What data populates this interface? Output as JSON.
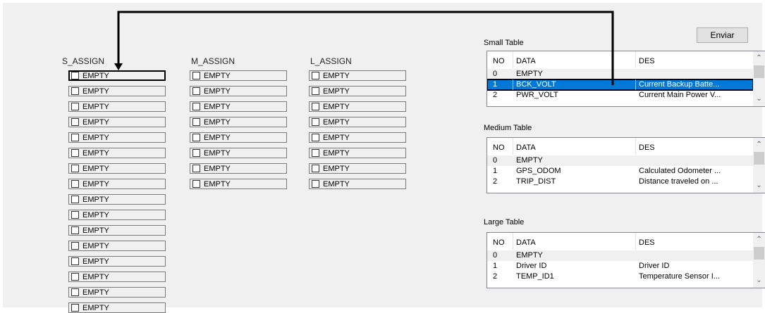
{
  "columns": {
    "s_assign": {
      "title": "S_ASSIGN",
      "items": [
        "EMPTY",
        "EMPTY",
        "EMPTY",
        "EMPTY",
        "EMPTY",
        "EMPTY",
        "EMPTY",
        "EMPTY",
        "EMPTY",
        "EMPTY",
        "EMPTY",
        "EMPTY",
        "EMPTY",
        "EMPTY",
        "EMPTY",
        "EMPTY"
      ]
    },
    "m_assign": {
      "title": "M_ASSIGN",
      "items": [
        "EMPTY",
        "EMPTY",
        "EMPTY",
        "EMPTY",
        "EMPTY",
        "EMPTY",
        "EMPTY",
        "EMPTY"
      ]
    },
    "l_assign": {
      "title": "L_ASSIGN",
      "items": [
        "EMPTY",
        "EMPTY",
        "EMPTY",
        "EMPTY",
        "EMPTY",
        "EMPTY",
        "EMPTY",
        "EMPTY"
      ]
    }
  },
  "send_button": {
    "label": "Enviar"
  },
  "tables": {
    "small": {
      "title": "Small Table",
      "headers": [
        "NO",
        "DATA",
        "DES"
      ],
      "rows": [
        [
          "0",
          "EMPTY",
          ""
        ],
        [
          "1",
          "BCK_VOLT",
          "Current Backup Batte..."
        ],
        [
          "2",
          "PWR_VOLT",
          "Current Main Power V..."
        ]
      ]
    },
    "medium": {
      "title": "Medium Table",
      "headers": [
        "NO",
        "DATA",
        "DES"
      ],
      "rows": [
        [
          "0",
          "EMPTY",
          ""
        ],
        [
          "1",
          "GPS_ODOM",
          "Calculated Odometer ..."
        ],
        [
          "2",
          "TRIP_DIST",
          "Distance traveled on ..."
        ]
      ]
    },
    "large": {
      "title": "Large Table",
      "headers": [
        "NO",
        "DATA",
        "DES"
      ],
      "rows": [
        [
          "0",
          "EMPTY",
          ""
        ],
        [
          "1",
          "Driver ID",
          "Driver ID"
        ],
        [
          "2",
          "TEMP_ID1",
          "Temperature Sensor I..."
        ]
      ]
    }
  },
  "icons": {
    "scroll_up": "chevron-up-icon",
    "scroll_down": "chevron-down-icon",
    "checkbox": "checkbox-icon",
    "drag_arrow": "arrow-icon"
  },
  "colors": {
    "selection": "#0078d7",
    "window": "#f0f0f0"
  }
}
